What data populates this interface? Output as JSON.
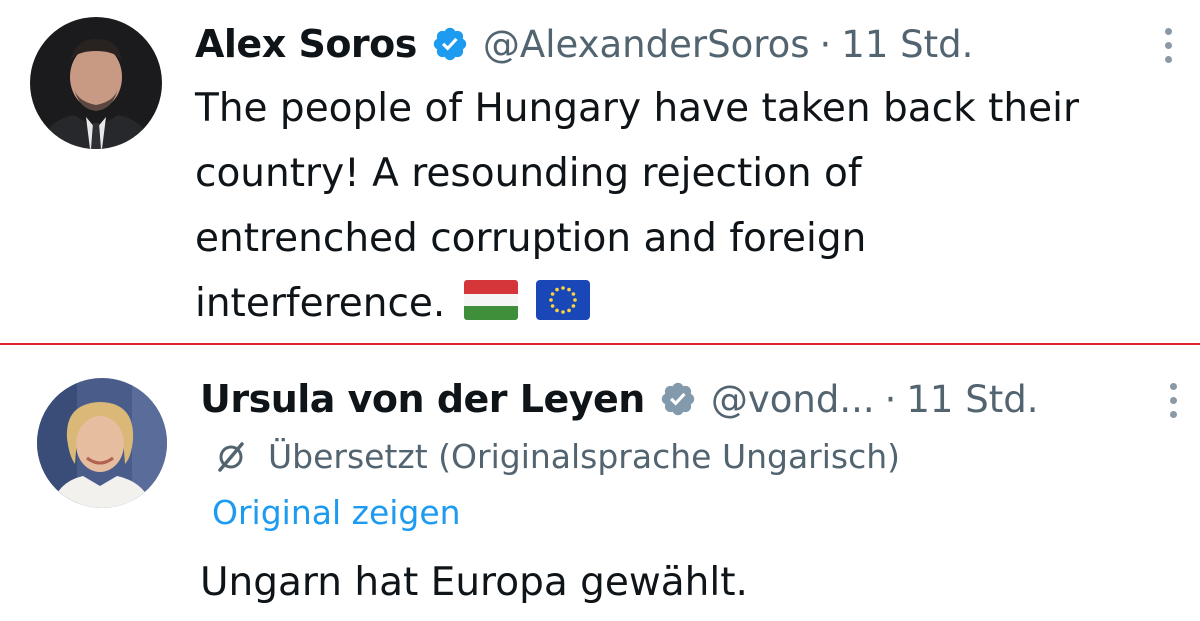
{
  "tweets": [
    {
      "author_name": "Alex Soros",
      "verified": true,
      "handle": "@AlexanderSoros",
      "separator": "·",
      "time": "11 Std.",
      "text_lines": [
        "The people of Hungary have taken back their",
        "country! A resounding rejection of",
        "entrenched corruption and foreign",
        "interference."
      ],
      "emojis": [
        "hungary-flag",
        "eu-flag"
      ]
    },
    {
      "author_name": "Ursula von der Leyen",
      "verified": true,
      "handle": "@vond...",
      "separator": "·",
      "time": "11 Std.",
      "translation_notice": "Übersetzt (Originalsprache Ungarisch)",
      "show_original_label": "Original zeigen",
      "text": "Ungarn hat Europa gewählt."
    }
  ],
  "colors": {
    "divider": "#e0242c",
    "verified_badge": "#1d9bf0",
    "link": "#1d9bf0",
    "secondary_text": "#536471",
    "primary_text": "#0f1419"
  }
}
